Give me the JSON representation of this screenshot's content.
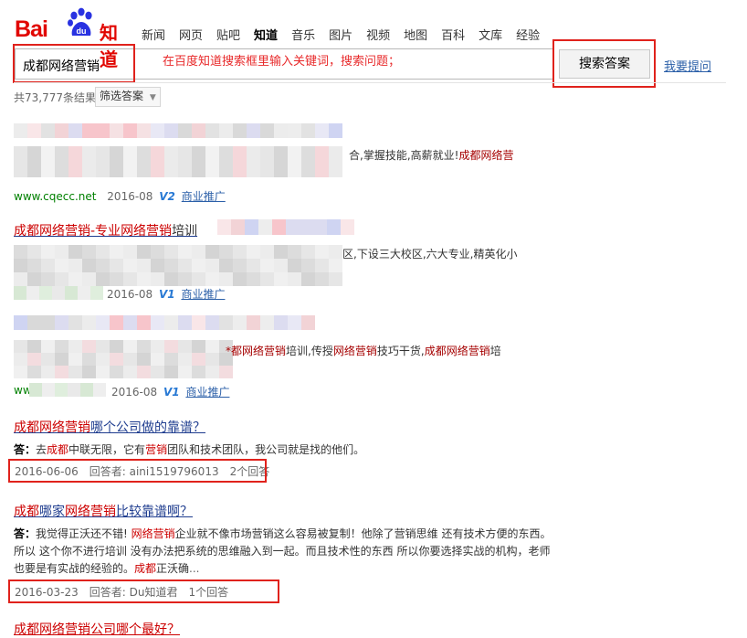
{
  "logo": {
    "bai": "Bai",
    "du": "du",
    "zhidao": "知道"
  },
  "nav": [
    {
      "label": "新闻",
      "active": false
    },
    {
      "label": "网页",
      "active": false
    },
    {
      "label": "贴吧",
      "active": false
    },
    {
      "label": "知道",
      "active": true
    },
    {
      "label": "音乐",
      "active": false
    },
    {
      "label": "图片",
      "active": false
    },
    {
      "label": "视频",
      "active": false
    },
    {
      "label": "地图",
      "active": false
    },
    {
      "label": "百科",
      "active": false
    },
    {
      "label": "文库",
      "active": false
    },
    {
      "label": "经验",
      "active": false
    }
  ],
  "search": {
    "query": "成都网络营销",
    "annotation": "在百度知道搜索框里输入关键词，搜索问题；",
    "button": "搜索答案",
    "ask_link": "我要提问"
  },
  "stats": {
    "count": "共73,777条结果",
    "filter": "筛选答案"
  },
  "ads": [
    {
      "snippet_plain": "合,掌握技能,高薪就业!",
      "snippet_hl": "成都网络营",
      "url": "www.cqecc.net",
      "date": "2016-08",
      "vlevel": "V2",
      "tag": "商业推广"
    },
    {
      "title_hl1": "成都网络营销",
      "title_plain1": "-专业",
      "title_hl2": "网络营销",
      "title_plain2": "培训",
      "snippet_plain": "区,下设三大校区,六大专业,精英化小",
      "url": "",
      "date": "2016-08",
      "vlevel": "V1",
      "tag": "商业推广"
    },
    {
      "snippet_parts": [
        {
          "t": "*都网络营销",
          "hl": true
        },
        {
          "t": "培训,传授",
          "hl": false
        },
        {
          "t": "网络营销",
          "hl": true
        },
        {
          "t": "技巧干货,",
          "hl": false
        },
        {
          "t": "成都网络营销",
          "hl": true
        },
        {
          "t": "培",
          "hl": false
        }
      ],
      "url": "www.",
      "date": "2016-08",
      "vlevel": "V1",
      "tag": "商业推广"
    }
  ],
  "questions": [
    {
      "title_parts": [
        {
          "t": "成都网络营销",
          "hl": true
        },
        {
          "t": "哪个公司做的靠谱？",
          "hl": false
        }
      ],
      "answer_label": "答：",
      "answer_parts": [
        {
          "t": "去",
          "hl": false
        },
        {
          "t": "成都",
          "hl": true
        },
        {
          "t": "中联无限，它有",
          "hl": false
        },
        {
          "t": "营销",
          "hl": true
        },
        {
          "t": "团队和技术团队，我公司就是找的他们。",
          "hl": false
        }
      ],
      "date": "2016-06-06",
      "answerer": "回答者: aini1519796013",
      "answers": "2个回答"
    },
    {
      "title_parts": [
        {
          "t": "成都",
          "hl": true
        },
        {
          "t": "哪家",
          "hl": false
        },
        {
          "t": "网络营销",
          "hl": true
        },
        {
          "t": "比较靠谱啊？",
          "hl": false
        }
      ],
      "answer_label": "答：",
      "answer_parts": [
        {
          "t": "我觉得正沃还不错! ",
          "hl": false
        },
        {
          "t": "网络营销",
          "hl": true
        },
        {
          "t": "企业就不像市场营销这么容易被复制！他除了营销思维 还有技术方便的东西。所以 这个你不进行培训 没有办法把系统的思维融入到一起。而且技术性的东西 所以你要选择实战的机构，老师也要是有实战的经验的。",
          "hl": false
        },
        {
          "t": "成都",
          "hl": true
        },
        {
          "t": "正沃确",
          "hl": false
        },
        {
          "t": "...",
          "hl": false,
          "more": true
        }
      ],
      "date": "2016-03-23",
      "answerer": "回答者: Du知道君",
      "answers": "1个回答"
    }
  ],
  "partial_next": {
    "title": "成都网络营销公司哪个最好？"
  },
  "colors": {
    "brand": "#e10601",
    "highlight": "#c00000",
    "link": "#2b5fa8",
    "annotation_box": "#e0221c"
  }
}
